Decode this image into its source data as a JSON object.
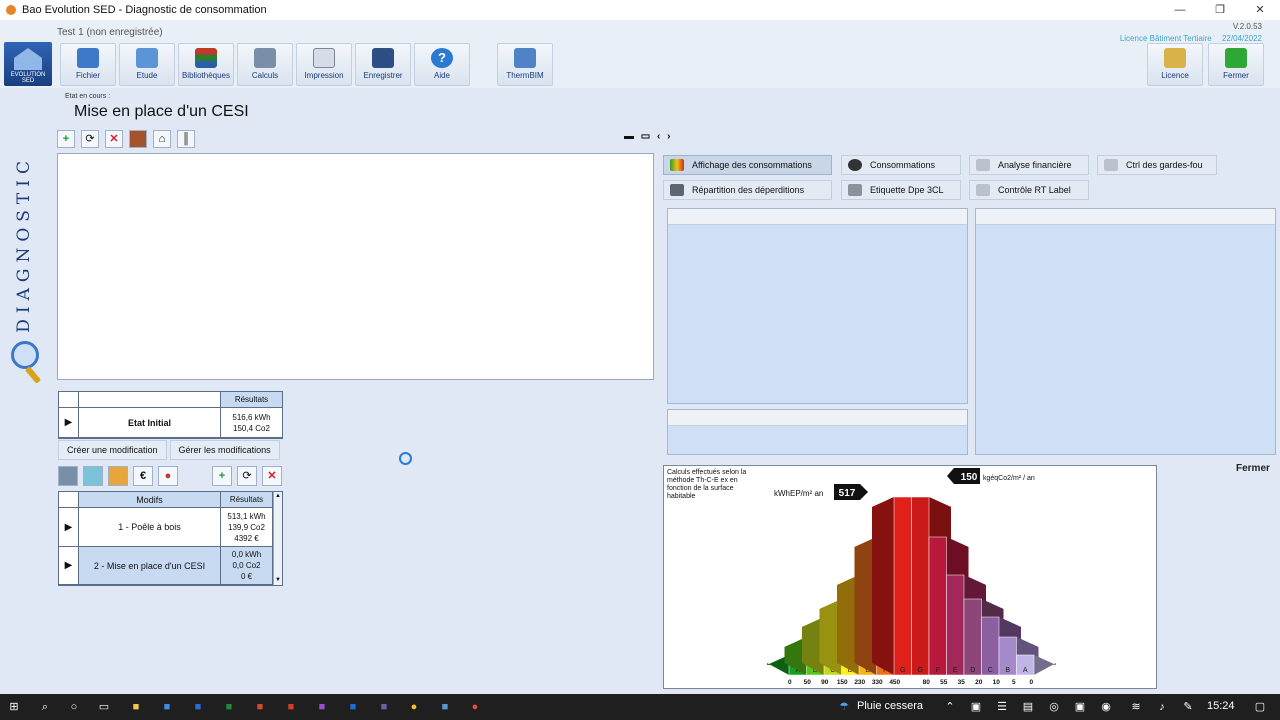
{
  "window": {
    "title": "Bao Evolution SED - Diagnostic de consommation",
    "controls": [
      "—",
      "❐",
      "✕"
    ]
  },
  "subtitle": "Test 1 (non enregistrée)",
  "version": "V.2.0.53",
  "licence_type": "Licence Bâtiment Tertiaire",
  "licence_date": "22/04/2022",
  "logo_text": "EVOLUTION SED",
  "toolbar": {
    "fichier": "Fichier",
    "etude": "Etude",
    "bibliotheques": "Bibliothèques",
    "calculs": "Calculs",
    "impression": "Impression",
    "enregistrer": "Enregistrer",
    "aide": "Aide",
    "thermbim": "ThermBIM",
    "licence": "Licence",
    "fermer": "Fermer"
  },
  "state": {
    "label": "Etat en cours :",
    "title": "Mise en place d'un CESI"
  },
  "vertical_label": "DIAGNOSTIC",
  "splitter": "▬ ▭ ‹ ›",
  "results": {
    "header": "Résultats",
    "initial_name": "Etat Initial",
    "initial_kwh": "516,6 kWh",
    "initial_co2": "150,4 Co2"
  },
  "mod_tabs": {
    "create": "Créer une modification",
    "manage": "Gérer les modifications"
  },
  "mods": {
    "col_modifs": "Modifs",
    "col_results": "Résultats",
    "rows": [
      {
        "name": "1 - Poêle à bois",
        "kwh": "513,1 kWh",
        "co2": "139,9 Co2",
        "cost": "4392 €"
      },
      {
        "name": "2 - Mise en place d'un CESI",
        "kwh": "0,0 kWh",
        "co2": "0,0 Co2",
        "cost": "0 €"
      }
    ]
  },
  "right_buttons": {
    "affichage": "Affichage des consommations",
    "consommations": "Consommations",
    "analyse": "Analyse financière",
    "ctrl": "Ctrl des gardes-fou",
    "repartition": "Répartition des déperditions",
    "etiquette": "Etiquette Dpe 3CL",
    "controle": "Contrôle RT Label"
  },
  "fermer_label": "Fermer",
  "chart_data": {
    "type": "bar",
    "note": "Calculs effectués selon la méthode Th-C-E ex en fonction de la surface habitable",
    "energy_value": "517",
    "energy_unit": "kWhEP/m² an",
    "ges_value": "150",
    "ges_unit": "kgéqCo2/m² / an",
    "energy_classes": [
      "A",
      "B",
      "C",
      "D",
      "E",
      "F",
      "G"
    ],
    "energy_thresholds": [
      "0",
      "50",
      "90",
      "150",
      "230",
      "330",
      "450"
    ],
    "ges_classes": [
      "G",
      "F",
      "E",
      "D",
      "C",
      "B",
      "A"
    ],
    "ges_thresholds": [
      "80",
      "55",
      "35",
      "20",
      "10",
      "5",
      "0"
    ],
    "energy_colors": [
      "#12a01e",
      "#58c617",
      "#c4d81a",
      "#fff11a",
      "#f7b512",
      "#ef6f1a",
      "#e0201b"
    ],
    "ges_colors": [
      "#cc1a1a",
      "#b8183c",
      "#a3285a",
      "#8d4678",
      "#8b5fa1",
      "#a48acb",
      "#c1b5e8"
    ]
  },
  "taskbar": {
    "weather": "Pluie cessera",
    "time": "15:24"
  }
}
